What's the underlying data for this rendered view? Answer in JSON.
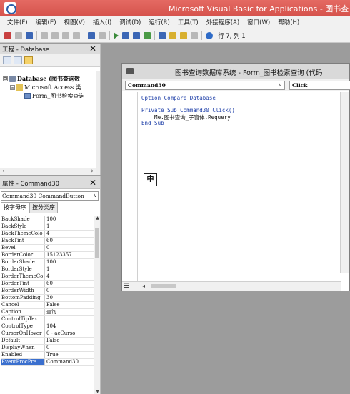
{
  "window": {
    "title": "Microsoft Visual Basic for Applications - 图书查"
  },
  "menu": [
    "文件(F)",
    "编辑(E)",
    "视图(V)",
    "插入(I)",
    "调试(D)",
    "运行(R)",
    "工具(T)",
    "外接程序(A)",
    "窗口(W)",
    "帮助(H)"
  ],
  "toolbar": {
    "position": "行 7, 列 1"
  },
  "project": {
    "title": "工程 - Database",
    "nodes": [
      {
        "toggle": "⊟",
        "label": "Database (图书查询数"
      },
      {
        "toggle": "⊟",
        "label": "Microsoft Access 类"
      },
      {
        "toggle": "",
        "label": "Form_图书检索查询"
      }
    ]
  },
  "properties": {
    "title": "属性 - Command30",
    "object": "Command30 CommandButton",
    "tabs": [
      "按字母序",
      "按分类序"
    ],
    "rows": [
      {
        "name": "BackShade",
        "value": "100"
      },
      {
        "name": "BackStyle",
        "value": "1"
      },
      {
        "name": "BackThemeColo",
        "value": "4"
      },
      {
        "name": "BackTint",
        "value": "60"
      },
      {
        "name": "Bevel",
        "value": "0"
      },
      {
        "name": "BorderColor",
        "value": "15123357"
      },
      {
        "name": "BorderShade",
        "value": "100"
      },
      {
        "name": "BorderStyle",
        "value": "1"
      },
      {
        "name": "BorderThemeCo",
        "value": "4"
      },
      {
        "name": "BorderTint",
        "value": "60"
      },
      {
        "name": "BorderWidth",
        "value": "0"
      },
      {
        "name": "BottomPadding",
        "value": "30"
      },
      {
        "name": "Cancel",
        "value": "False"
      },
      {
        "name": "Caption",
        "value": "查询"
      },
      {
        "name": "ControlTipTex",
        "value": ""
      },
      {
        "name": "ControlType",
        "value": "104"
      },
      {
        "name": "CursorOnHover",
        "value": "0 - acCurso"
      },
      {
        "name": "Default",
        "value": "False"
      },
      {
        "name": "DisplayWhen",
        "value": "0"
      },
      {
        "name": "Enabled",
        "value": "True"
      },
      {
        "name": "EventProcPre",
        "value": "Command30"
      }
    ]
  },
  "code_window": {
    "title": "图书查询数据库系统 - Form_图书检索查询 (代码",
    "object_combo": "Command30",
    "proc_combo": "Click",
    "lines": [
      {
        "text": "Option Compare Database",
        "kind": "keyword"
      },
      {
        "text": "Private Sub Command30_Click()",
        "kind": "keyword"
      },
      {
        "text": "    Me.图书查询_子窗体.Requery",
        "kind": "code"
      },
      {
        "text": "End Sub",
        "kind": "keyword"
      }
    ],
    "ime_indicator": "中"
  },
  "colors": {
    "titlebar": "#d6534d",
    "keyword": "#1e3fa8",
    "selection": "#3a6fce",
    "mdi_background": "#9c9c9c"
  }
}
